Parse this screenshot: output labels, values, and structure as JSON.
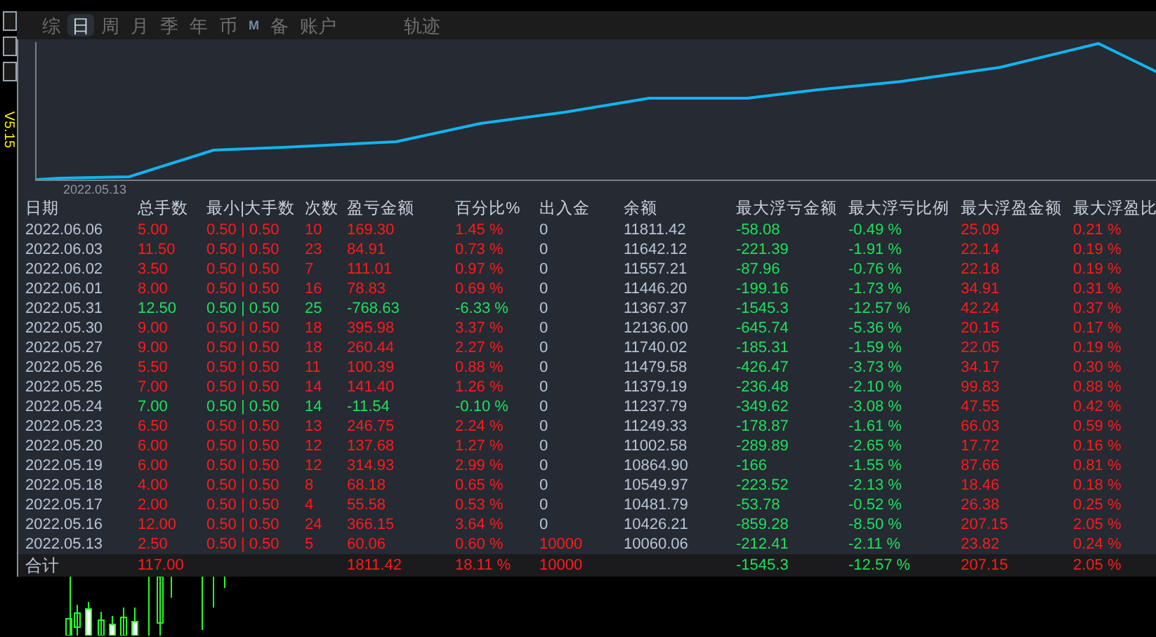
{
  "side_label": "V5.15",
  "tabs": [
    {
      "label": "综",
      "selected": false
    },
    {
      "label": "日",
      "selected": true
    },
    {
      "label": "周",
      "selected": false
    },
    {
      "label": "月",
      "selected": false
    },
    {
      "label": "季",
      "selected": false
    },
    {
      "label": "年",
      "selected": false
    },
    {
      "label": "币",
      "selected": false
    },
    {
      "label": "M",
      "selected": false
    },
    {
      "label": "备",
      "selected": false
    },
    {
      "label": "账户",
      "selected": false
    },
    {
      "label": "轨迹",
      "selected": false
    }
  ],
  "equity_chart": {
    "start_label": "2022.05.13"
  },
  "table": {
    "columns": [
      "日期",
      "总手数",
      "最小|大手数",
      "次数",
      "盈亏金额",
      "百分比%",
      "出入金",
      "余额",
      "最大浮亏金额",
      "最大浮亏比例",
      "最大浮盈金额",
      "最大浮盈比"
    ],
    "rows": [
      {
        "kind": "profit",
        "deposit_nonzero": false,
        "cells": [
          "2022.06.06",
          "5.00",
          "0.50 | 0.50",
          "10",
          "169.30",
          "1.45 %",
          "0",
          "11811.42",
          "-58.08",
          "-0.49 %",
          "25.09",
          "0.21 %"
        ]
      },
      {
        "kind": "profit",
        "deposit_nonzero": false,
        "cells": [
          "2022.06.03",
          "11.50",
          "0.50 | 0.50",
          "23",
          "84.91",
          "0.73 %",
          "0",
          "11642.12",
          "-221.39",
          "-1.91 %",
          "22.14",
          "0.19 %"
        ]
      },
      {
        "kind": "profit",
        "deposit_nonzero": false,
        "cells": [
          "2022.06.02",
          "3.50",
          "0.50 | 0.50",
          "7",
          "111.01",
          "0.97 %",
          "0",
          "11557.21",
          "-87.96",
          "-0.76 %",
          "22.18",
          "0.19 %"
        ]
      },
      {
        "kind": "profit",
        "deposit_nonzero": false,
        "cells": [
          "2022.06.01",
          "8.00",
          "0.50 | 0.50",
          "16",
          "78.83",
          "0.69 %",
          "0",
          "11446.20",
          "-199.16",
          "-1.73 %",
          "34.91",
          "0.31 %"
        ]
      },
      {
        "kind": "loss",
        "deposit_nonzero": false,
        "cells": [
          "2022.05.31",
          "12.50",
          "0.50 | 0.50",
          "25",
          "-768.63",
          "-6.33 %",
          "0",
          "11367.37",
          "-1545.3",
          "-12.57 %",
          "42.24",
          "0.37 %"
        ]
      },
      {
        "kind": "profit",
        "deposit_nonzero": false,
        "cells": [
          "2022.05.30",
          "9.00",
          "0.50 | 0.50",
          "18",
          "395.98",
          "3.37 %",
          "0",
          "12136.00",
          "-645.74",
          "-5.36 %",
          "20.15",
          "0.17 %"
        ]
      },
      {
        "kind": "profit",
        "deposit_nonzero": false,
        "cells": [
          "2022.05.27",
          "9.00",
          "0.50 | 0.50",
          "18",
          "260.44",
          "2.27 %",
          "0",
          "11740.02",
          "-185.31",
          "-1.59 %",
          "22.05",
          "0.19 %"
        ]
      },
      {
        "kind": "profit",
        "deposit_nonzero": false,
        "cells": [
          "2022.05.26",
          "5.50",
          "0.50 | 0.50",
          "11",
          "100.39",
          "0.88 %",
          "0",
          "11479.58",
          "-426.47",
          "-3.73 %",
          "34.17",
          "0.30 %"
        ]
      },
      {
        "kind": "profit",
        "deposit_nonzero": false,
        "cells": [
          "2022.05.25",
          "7.00",
          "0.50 | 0.50",
          "14",
          "141.40",
          "1.26 %",
          "0",
          "11379.19",
          "-236.48",
          "-2.10 %",
          "99.83",
          "0.88 %"
        ]
      },
      {
        "kind": "loss",
        "deposit_nonzero": false,
        "cells": [
          "2022.05.24",
          "7.00",
          "0.50 | 0.50",
          "14",
          "-11.54",
          "-0.10 %",
          "0",
          "11237.79",
          "-349.62",
          "-3.08 %",
          "47.55",
          "0.42 %"
        ]
      },
      {
        "kind": "profit",
        "deposit_nonzero": false,
        "cells": [
          "2022.05.23",
          "6.50",
          "0.50 | 0.50",
          "13",
          "246.75",
          "2.24 %",
          "0",
          "11249.33",
          "-178.87",
          "-1.61 %",
          "66.03",
          "0.59 %"
        ]
      },
      {
        "kind": "profit",
        "deposit_nonzero": false,
        "cells": [
          "2022.05.20",
          "6.00",
          "0.50 | 0.50",
          "12",
          "137.68",
          "1.27 %",
          "0",
          "11002.58",
          "-289.89",
          "-2.65 %",
          "17.72",
          "0.16 %"
        ]
      },
      {
        "kind": "profit",
        "deposit_nonzero": false,
        "cells": [
          "2022.05.19",
          "6.00",
          "0.50 | 0.50",
          "12",
          "314.93",
          "2.99 %",
          "0",
          "10864.90",
          "-166",
          "-1.55 %",
          "87.66",
          "0.81 %"
        ]
      },
      {
        "kind": "profit",
        "deposit_nonzero": false,
        "cells": [
          "2022.05.18",
          "4.00",
          "0.50 | 0.50",
          "8",
          "68.18",
          "0.65 %",
          "0",
          "10549.97",
          "-223.52",
          "-2.13 %",
          "18.46",
          "0.18 %"
        ]
      },
      {
        "kind": "profit",
        "deposit_nonzero": false,
        "cells": [
          "2022.05.17",
          "2.00",
          "0.50 | 0.50",
          "4",
          "55.58",
          "0.53 %",
          "0",
          "10481.79",
          "-53.78",
          "-0.52 %",
          "26.38",
          "0.25 %"
        ]
      },
      {
        "kind": "profit",
        "deposit_nonzero": false,
        "cells": [
          "2022.05.16",
          "12.00",
          "0.50 | 0.50",
          "24",
          "366.15",
          "3.64 %",
          "0",
          "10426.21",
          "-859.28",
          "-8.50 %",
          "207.15",
          "2.05 %"
        ]
      },
      {
        "kind": "profit",
        "deposit_nonzero": true,
        "cells": [
          "2022.05.13",
          "2.50",
          "0.50 | 0.50",
          "5",
          "60.06",
          "0.60 %",
          "10000",
          "10060.06",
          "-212.41",
          "-2.11 %",
          "23.82",
          "0.24 %"
        ]
      }
    ],
    "total": {
      "kind": "profit",
      "cells": [
        "合计",
        "117.00",
        "",
        "",
        "1811.42",
        "18.11 %",
        "10000",
        "",
        "-1545.3",
        "-12.57 %",
        "207.15",
        "2.05 %"
      ]
    }
  }
}
